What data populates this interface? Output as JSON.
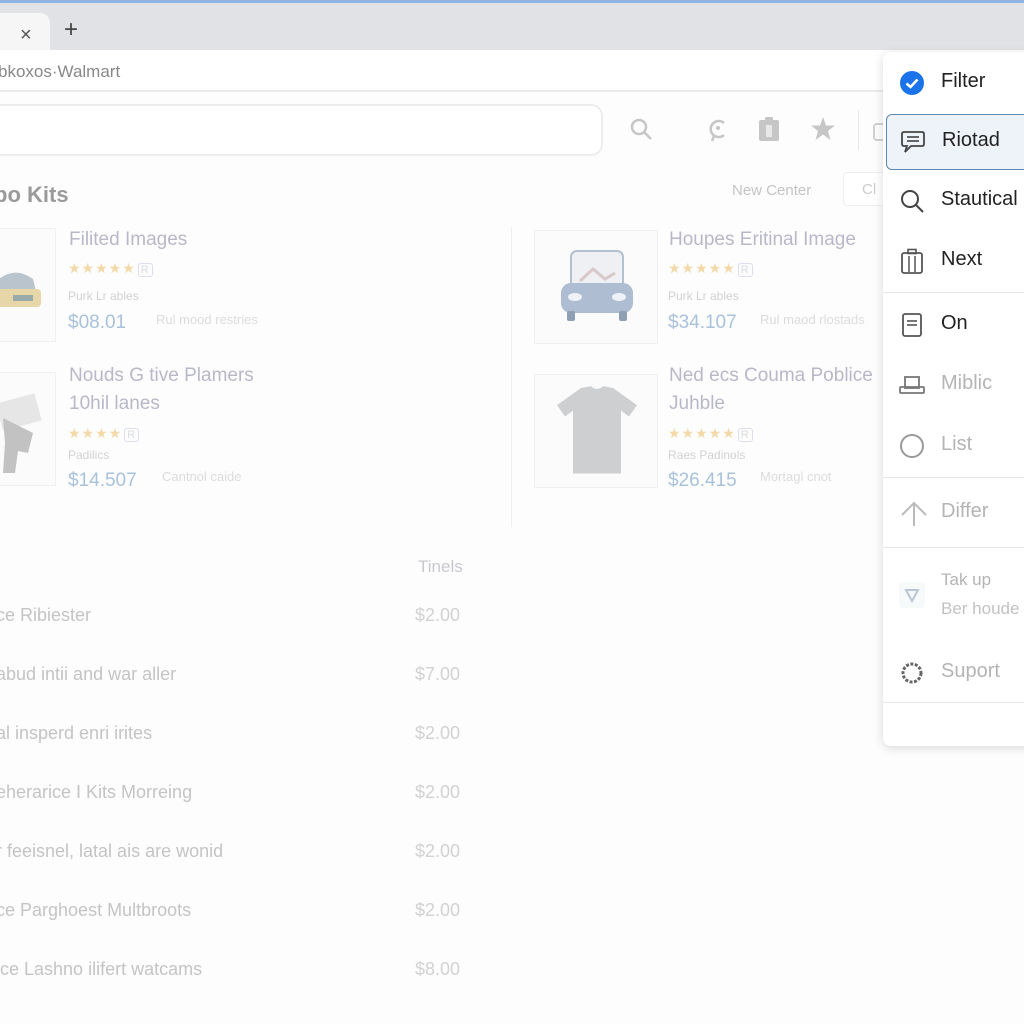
{
  "browser": {
    "tab_close": "×",
    "new_tab": "+",
    "address": "bkoxos·Walmart"
  },
  "toolbar": {
    "icons": [
      "search-icon",
      "coupon-icon",
      "clipboard-icon",
      "star-icon",
      "share-icon"
    ]
  },
  "section": {
    "title": "bo Kits",
    "new_center": "New Center",
    "ch_button": "Cl"
  },
  "products": [
    {
      "title": "Filited Images",
      "title2": "",
      "seller": "Purk Lr ables",
      "price": "$08.01",
      "shipping": "Rul mood restries",
      "stars": "★★★★★",
      "badge": "R"
    },
    {
      "title": "Houpes Eritinal Image",
      "title2": "",
      "seller": "Purk Lr ables",
      "price": "$34.107",
      "shipping": "Rul maod rlostads",
      "stars": "★★★★★",
      "badge": "R"
    },
    {
      "title": "Nouds G tive Plamers",
      "title2": "10hil lanes",
      "seller": "Padilics",
      "price": "$14.507",
      "shipping": "Cantnol caide",
      "stars": "★★★★",
      "badge": "R"
    },
    {
      "title": "Ned ecs Couma Poblice",
      "title2": "Juhble",
      "seller": "Raes Padinols",
      "price": "$26.415",
      "shipping": "Mortagl cnot",
      "stars": "★★★★★",
      "badge": "R"
    }
  ],
  "table": {
    "header": "Tinels",
    "rows": [
      {
        "name": "ce Ribiester",
        "price": "$2.00"
      },
      {
        "name": "abud intii and war aller",
        "price": "$7.00"
      },
      {
        "name": "al insperd enri irites",
        "price": "$2.00"
      },
      {
        "name": "eherarice I Kits Morreing",
        "price": "$2.00"
      },
      {
        "name": "r feeisnel, latal ais are wonid",
        "price": "$2.00"
      },
      {
        "name": "ce Parghoest Multbroots",
        "price": "$2.00"
      },
      {
        "name": "ice Lashno ilifert watcams",
        "price": "$8.00"
      }
    ]
  },
  "menu": {
    "items": [
      {
        "label": "Filter",
        "icon": "check-circle-icon",
        "checked": true
      },
      {
        "label": "Riotad",
        "icon": "chat-list-icon",
        "selected": true
      },
      {
        "label": "Stautical",
        "icon": "search-icon"
      },
      {
        "label": "Next",
        "icon": "clipboard-icon"
      },
      {
        "label": "On",
        "icon": "document-icon"
      },
      {
        "label": "Miblic",
        "icon": "printer-icon"
      },
      {
        "label": "List",
        "icon": "circle-icon"
      },
      {
        "label": "Differ",
        "icon": "arrow-up-icon"
      },
      {
        "label": "Tak up",
        "sub": "Ber houde",
        "icon": "triangle-down-icon"
      },
      {
        "label": "Suport",
        "icon": "gear-icon"
      }
    ]
  },
  "colors": {
    "accent": "#1a73e8",
    "price": "#a9c2dc",
    "star": "#f3d9a7"
  }
}
